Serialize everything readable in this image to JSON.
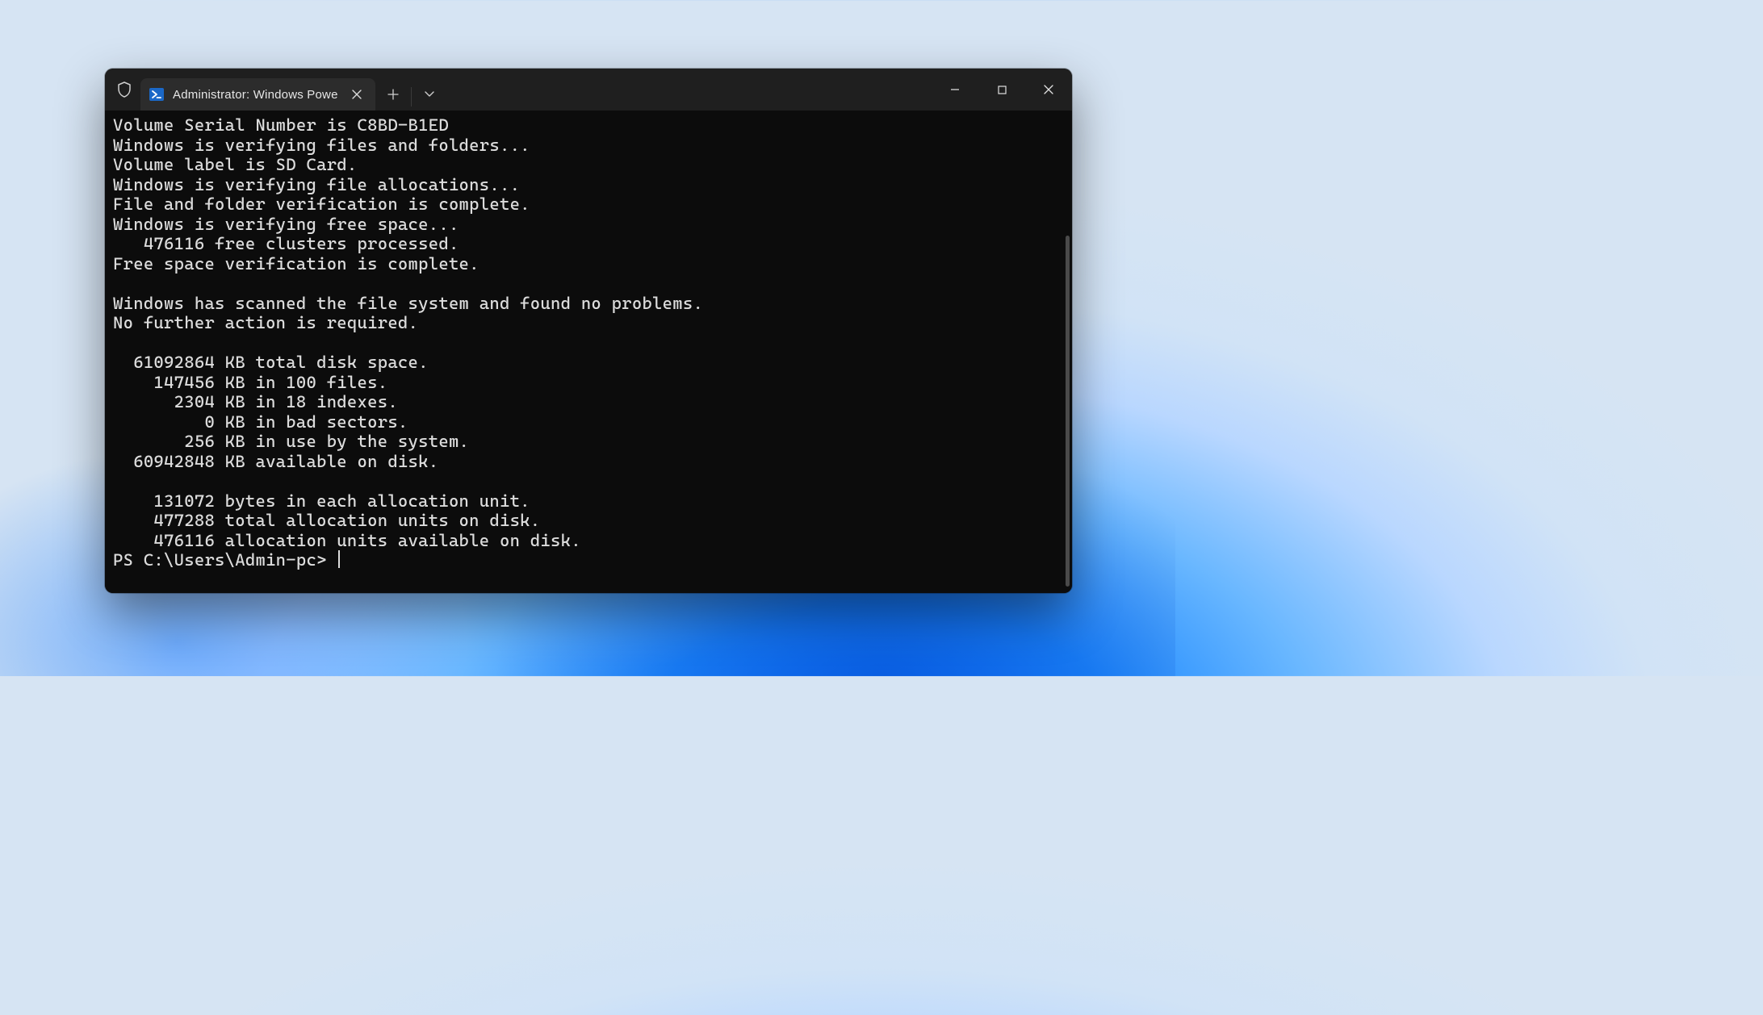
{
  "titlebar": {
    "tab_label": "Administrator: Windows Powe"
  },
  "terminal": {
    "lines": [
      "Volume Serial Number is C8BD-B1ED",
      "Windows is verifying files and folders...",
      "Volume label is SD Card.",
      "Windows is verifying file allocations...",
      "File and folder verification is complete.",
      "Windows is verifying free space...",
      "   476116 free clusters processed.",
      "Free space verification is complete.",
      "",
      "Windows has scanned the file system and found no problems.",
      "No further action is required.",
      "",
      "  61092864 KB total disk space.",
      "    147456 KB in 100 files.",
      "      2304 KB in 18 indexes.",
      "         0 KB in bad sectors.",
      "       256 KB in use by the system.",
      "  60942848 KB available on disk.",
      "",
      "    131072 bytes in each allocation unit.",
      "    477288 total allocation units on disk.",
      "    476116 allocation units available on disk."
    ],
    "prompt": "PS C:\\Users\\Admin-pc> "
  }
}
